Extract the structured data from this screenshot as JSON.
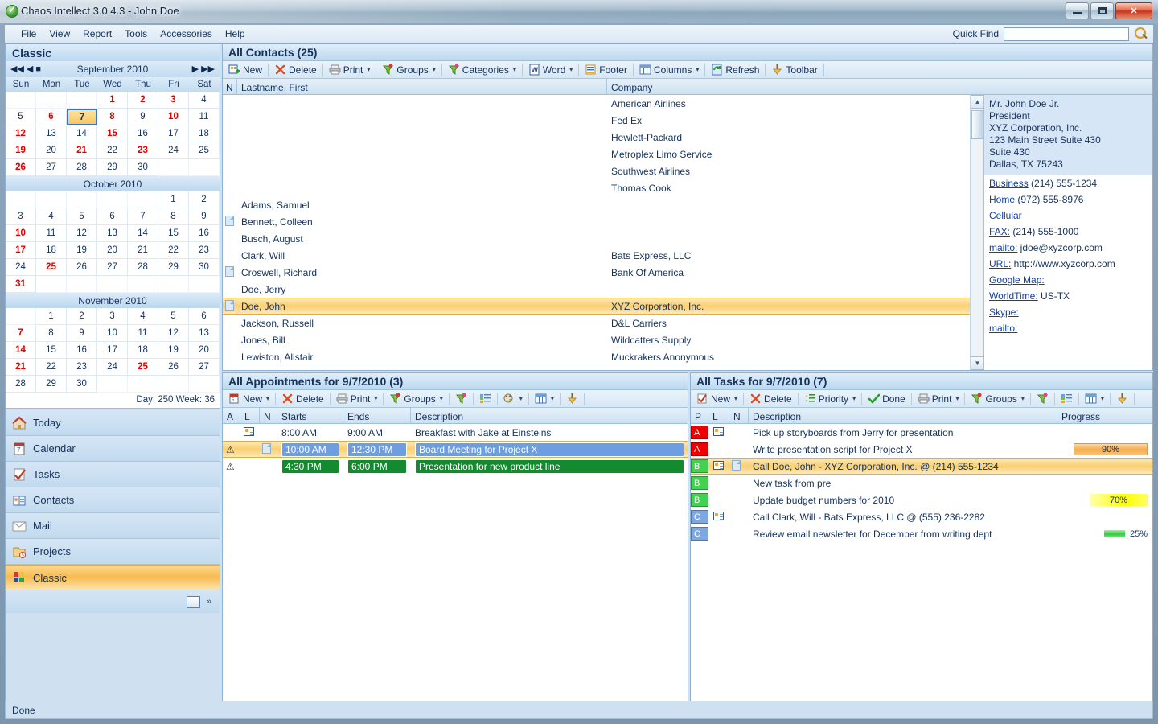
{
  "window": {
    "title": "Chaos Intellect 3.0.4.3 - John Doe",
    "minimize": "–",
    "maximize": "□",
    "close": "✕"
  },
  "menubar": {
    "items": [
      "File",
      "View",
      "Report",
      "Tools",
      "Accessories",
      "Help"
    ],
    "quick_find_label": "Quick Find",
    "quick_find_value": "",
    "quick_find_placeholder": ""
  },
  "sidebar": {
    "title": "Classic",
    "nav": {
      "first": "◀◀",
      "prev": "◀",
      "today": "■",
      "next": "▶",
      "last": "▶▶"
    },
    "dow": [
      "Sun",
      "Mon",
      "Tue",
      "Wed",
      "Thu",
      "Fri",
      "Sat"
    ],
    "months": [
      {
        "label": "September 2010",
        "lead_blanks": 3,
        "days": [
          {
            "n": 1,
            "hl": true
          },
          {
            "n": 2,
            "hl": true
          },
          {
            "n": 3,
            "hl": true
          },
          {
            "n": 4,
            "hl": false
          },
          {
            "n": 5,
            "hl": false
          },
          {
            "n": 6,
            "hl": true
          },
          {
            "n": 7,
            "hl": false,
            "sel": true
          },
          {
            "n": 8,
            "hl": true
          },
          {
            "n": 9,
            "hl": false
          },
          {
            "n": 10,
            "hl": true
          },
          {
            "n": 11,
            "hl": false
          },
          {
            "n": 12,
            "hl": true
          },
          {
            "n": 13,
            "hl": false
          },
          {
            "n": 14,
            "hl": false
          },
          {
            "n": 15,
            "hl": true
          },
          {
            "n": 16,
            "hl": false
          },
          {
            "n": 17,
            "hl": false
          },
          {
            "n": 18,
            "hl": false
          },
          {
            "n": 19,
            "hl": true
          },
          {
            "n": 20,
            "hl": false
          },
          {
            "n": 21,
            "hl": true
          },
          {
            "n": 22,
            "hl": false
          },
          {
            "n": 23,
            "hl": true
          },
          {
            "n": 24,
            "hl": false
          },
          {
            "n": 25,
            "hl": false
          },
          {
            "n": 26,
            "hl": true
          },
          {
            "n": 27,
            "hl": false
          },
          {
            "n": 28,
            "hl": false
          },
          {
            "n": 29,
            "hl": false
          },
          {
            "n": 30,
            "hl": false
          }
        ]
      },
      {
        "label": "October 2010",
        "lead_blanks": 5,
        "days": [
          {
            "n": 1,
            "hl": false
          },
          {
            "n": 2,
            "hl": false
          },
          {
            "n": 3,
            "hl": false
          },
          {
            "n": 4,
            "hl": false
          },
          {
            "n": 5,
            "hl": false
          },
          {
            "n": 6,
            "hl": false
          },
          {
            "n": 7,
            "hl": false
          },
          {
            "n": 8,
            "hl": false
          },
          {
            "n": 9,
            "hl": false
          },
          {
            "n": 10,
            "hl": true
          },
          {
            "n": 11,
            "hl": false
          },
          {
            "n": 12,
            "hl": false
          },
          {
            "n": 13,
            "hl": false
          },
          {
            "n": 14,
            "hl": false
          },
          {
            "n": 15,
            "hl": false
          },
          {
            "n": 16,
            "hl": false
          },
          {
            "n": 17,
            "hl": true
          },
          {
            "n": 18,
            "hl": false
          },
          {
            "n": 19,
            "hl": false
          },
          {
            "n": 20,
            "hl": false
          },
          {
            "n": 21,
            "hl": false
          },
          {
            "n": 22,
            "hl": false
          },
          {
            "n": 23,
            "hl": false
          },
          {
            "n": 24,
            "hl": false
          },
          {
            "n": 25,
            "hl": true
          },
          {
            "n": 26,
            "hl": false
          },
          {
            "n": 27,
            "hl": false
          },
          {
            "n": 28,
            "hl": false
          },
          {
            "n": 29,
            "hl": false
          },
          {
            "n": 30,
            "hl": false
          },
          {
            "n": 31,
            "hl": true
          }
        ]
      },
      {
        "label": "November 2010",
        "lead_blanks": 1,
        "days": [
          {
            "n": 1,
            "hl": false
          },
          {
            "n": 2,
            "hl": false
          },
          {
            "n": 3,
            "hl": false
          },
          {
            "n": 4,
            "hl": false
          },
          {
            "n": 5,
            "hl": false
          },
          {
            "n": 6,
            "hl": false
          },
          {
            "n": 7,
            "hl": true
          },
          {
            "n": 8,
            "hl": false
          },
          {
            "n": 9,
            "hl": false
          },
          {
            "n": 10,
            "hl": false
          },
          {
            "n": 11,
            "hl": false
          },
          {
            "n": 12,
            "hl": false
          },
          {
            "n": 13,
            "hl": false
          },
          {
            "n": 14,
            "hl": true
          },
          {
            "n": 15,
            "hl": false
          },
          {
            "n": 16,
            "hl": false
          },
          {
            "n": 17,
            "hl": false
          },
          {
            "n": 18,
            "hl": false
          },
          {
            "n": 19,
            "hl": false
          },
          {
            "n": 20,
            "hl": false
          },
          {
            "n": 21,
            "hl": true
          },
          {
            "n": 22,
            "hl": false
          },
          {
            "n": 23,
            "hl": false
          },
          {
            "n": 24,
            "hl": false
          },
          {
            "n": 25,
            "hl": true
          },
          {
            "n": 26,
            "hl": false
          },
          {
            "n": 27,
            "hl": false
          },
          {
            "n": 28,
            "hl": false
          },
          {
            "n": 29,
            "hl": false
          },
          {
            "n": 30,
            "hl": false
          }
        ]
      }
    ],
    "daynum": "Day: 250  Week: 36",
    "items": [
      {
        "label": "Today",
        "icon": "today-icon",
        "active": false
      },
      {
        "label": "Calendar",
        "icon": "calendar-icon",
        "active": false
      },
      {
        "label": "Tasks",
        "icon": "tasks-icon",
        "active": false
      },
      {
        "label": "Contacts",
        "icon": "contacts-icon",
        "active": false
      },
      {
        "label": "Mail",
        "icon": "mail-icon",
        "active": false
      },
      {
        "label": "Projects",
        "icon": "projects-icon",
        "active": false
      },
      {
        "label": "Classic",
        "icon": "classic-icon",
        "active": true
      }
    ]
  },
  "contacts": {
    "header": "All Contacts (25)",
    "toolbar": [
      {
        "label": "New",
        "icon": "new-contact-icon",
        "caret": false
      },
      {
        "label": "Delete",
        "icon": "delete-x-icon",
        "caret": false
      },
      {
        "label": "Print",
        "icon": "printer-icon",
        "caret": true
      },
      {
        "label": "Groups",
        "icon": "funnel-red-icon",
        "caret": true
      },
      {
        "label": "Categories",
        "icon": "funnel-green-icon",
        "caret": true
      },
      {
        "label": "Word",
        "icon": "word-icon",
        "caret": true
      },
      {
        "label": "Footer",
        "icon": "footer-icon",
        "caret": false
      },
      {
        "label": "Columns",
        "icon": "columns-icon",
        "caret": true
      },
      {
        "label": "Refresh",
        "icon": "refresh-icon",
        "caret": false
      },
      {
        "label": "Toolbar",
        "icon": "toolbar-icon",
        "caret": false
      }
    ],
    "columns": [
      "N",
      "Lastname, First",
      "Company"
    ],
    "rows": [
      {
        "note": false,
        "name": "",
        "company": "American Airlines",
        "selected": false
      },
      {
        "note": false,
        "name": "",
        "company": "Fed Ex",
        "selected": false
      },
      {
        "note": false,
        "name": "",
        "company": "Hewlett-Packard",
        "selected": false
      },
      {
        "note": false,
        "name": "",
        "company": "Metroplex Limo Service",
        "selected": false
      },
      {
        "note": false,
        "name": "",
        "company": "Southwest Airlines",
        "selected": false
      },
      {
        "note": false,
        "name": "",
        "company": "Thomas Cook",
        "selected": false
      },
      {
        "note": false,
        "name": "Adams, Samuel",
        "company": "",
        "selected": false
      },
      {
        "note": true,
        "name": "Bennett, Colleen",
        "company": "",
        "selected": false
      },
      {
        "note": false,
        "name": "Busch, August",
        "company": "",
        "selected": false
      },
      {
        "note": false,
        "name": "Clark, Will",
        "company": "Bats Express, LLC",
        "selected": false
      },
      {
        "note": true,
        "name": "Croswell, Richard",
        "company": "Bank Of America",
        "selected": false
      },
      {
        "note": false,
        "name": "Doe, Jerry",
        "company": "",
        "selected": false
      },
      {
        "note": true,
        "name": "Doe, John",
        "company": "XYZ Corporation, Inc.",
        "selected": true
      },
      {
        "note": false,
        "name": "Jackson, Russell",
        "company": "D&L  Carriers",
        "selected": false
      },
      {
        "note": false,
        "name": "Jones, Bill",
        "company": "Wildcatters Supply",
        "selected": false
      },
      {
        "note": false,
        "name": "Lewiston, Alistair",
        "company": "Muckrakers Anonymous",
        "selected": false
      }
    ],
    "detail": {
      "address_lines": [
        "Mr. John Doe Jr.",
        "President",
        "XYZ Corporation, Inc.",
        "123 Main Street Suite 430",
        "Suite 430",
        "Dallas, TX 75243"
      ],
      "fields": [
        {
          "link": "Business",
          "value": "(214) 555-1234"
        },
        {
          "link": "Home",
          "value": "(972) 555-8976"
        },
        {
          "link": "Cellular",
          "value": ""
        },
        {
          "link": "FAX:",
          "value": "(214) 555-1000"
        },
        {
          "link": "mailto:",
          "value": "jdoe@xyzcorp.com"
        },
        {
          "link": "URL:",
          "value": "http://www.xyzcorp.com"
        },
        {
          "link": "Google Map:",
          "value": ""
        },
        {
          "link": "WorldTime:",
          "value": "US-TX"
        },
        {
          "link": "Skype:",
          "value": ""
        },
        {
          "link": "mailto:",
          "value": ""
        }
      ]
    }
  },
  "appointments": {
    "header": "All Appointments for 9/7/2010 (3)",
    "toolbar": [
      {
        "label": "New",
        "icon": "new-appointment-icon",
        "caret": true
      },
      {
        "label": "Delete",
        "icon": "delete-x-icon",
        "caret": false
      },
      {
        "label": "Print",
        "icon": "printer-icon",
        "caret": true
      },
      {
        "label": "Groups",
        "icon": "funnel-red-icon",
        "caret": true
      },
      {
        "label": "",
        "icon": "funnel-green-icon",
        "caret": false
      },
      {
        "label": "",
        "icon": "outline-icon",
        "caret": false
      },
      {
        "label": "",
        "icon": "colors-icon",
        "caret": true
      },
      {
        "label": "",
        "icon": "columns-icon",
        "caret": true
      },
      {
        "label": "",
        "icon": "toolbar-icon",
        "caret": false
      }
    ],
    "columns": [
      "A",
      "L",
      "N",
      "Starts",
      "Ends",
      "Description"
    ],
    "rows": [
      {
        "alarm": false,
        "link": "card",
        "note": false,
        "starts": "8:00 AM",
        "ends": "9:00 AM",
        "description": "Breakfast with Jake at Einsteins",
        "style": "none",
        "selected": false
      },
      {
        "alarm": true,
        "link": "",
        "note": true,
        "starts": "10:00 AM",
        "ends": "12:30 PM",
        "description": "Board Meeting for Project X",
        "style": "blue",
        "selected": true
      },
      {
        "alarm": true,
        "link": "",
        "note": false,
        "starts": "4:30 PM",
        "ends": "6:00 PM",
        "description": "Presentation for new product line",
        "style": "green",
        "selected": false
      }
    ]
  },
  "tasks": {
    "header": "All Tasks for 9/7/2010 (7)",
    "toolbar": [
      {
        "label": "New",
        "icon": "new-task-icon",
        "caret": true
      },
      {
        "label": "Delete",
        "icon": "delete-x-icon",
        "caret": false
      },
      {
        "label": "Priority",
        "icon": "priority-icon",
        "caret": true
      },
      {
        "label": "Done",
        "icon": "check-icon",
        "caret": false
      },
      {
        "label": "Print",
        "icon": "printer-icon",
        "caret": true
      },
      {
        "label": "Groups",
        "icon": "funnel-red-icon",
        "caret": true
      },
      {
        "label": "",
        "icon": "funnel-green-icon",
        "caret": false
      },
      {
        "label": "",
        "icon": "outline-icon",
        "caret": false
      },
      {
        "label": "",
        "icon": "columns-icon",
        "caret": true
      },
      {
        "label": "",
        "icon": "toolbar-icon",
        "caret": false
      }
    ],
    "columns": [
      "P",
      "L",
      "N",
      "Description",
      "Progress"
    ],
    "rows": [
      {
        "priority": "A",
        "link": "card",
        "note": false,
        "description": "Pick up storyboards from Jerry for presentation",
        "progress": "",
        "progress_pct": 0,
        "bar": "none",
        "selected": false
      },
      {
        "priority": "A",
        "link": "",
        "note": false,
        "description": "Write presentation script for Project X",
        "progress": "90%",
        "progress_pct": 90,
        "bar": "orange",
        "selected": false
      },
      {
        "priority": "B",
        "link": "card",
        "note": true,
        "description": "Call Doe, John - XYZ Corporation, Inc. @ (214) 555-1234",
        "progress": "",
        "progress_pct": 0,
        "bar": "none",
        "selected": true
      },
      {
        "priority": "B",
        "link": "",
        "note": false,
        "description": "New task from pre",
        "progress": "",
        "progress_pct": 0,
        "bar": "none",
        "selected": false
      },
      {
        "priority": "B",
        "link": "",
        "note": false,
        "description": "Update budget numbers for 2010",
        "progress": "70%",
        "progress_pct": 70,
        "bar": "yellow",
        "selected": false
      },
      {
        "priority": "C",
        "link": "card",
        "note": false,
        "description": "Call Clark, Will - Bats Express, LLC @ (555) 236-2282",
        "progress": "",
        "progress_pct": 0,
        "bar": "none",
        "selected": false
      },
      {
        "priority": "C",
        "link": "",
        "note": false,
        "description": "Review email newsletter for December from writing dept",
        "progress": "25%",
        "progress_pct": 25,
        "bar": "green",
        "selected": false
      }
    ]
  },
  "statusbar": {
    "text": "Done"
  },
  "colors": {
    "accent_blue": "#1a3260",
    "selection_gold": "#f9cf72",
    "priority_a": "#ef0000",
    "priority_b": "#44d152",
    "priority_c": "#7fa8e0",
    "progress_orange": "#f5ab4d",
    "progress_yellow": "#ffff00",
    "progress_green": "#2ecc40",
    "appt_blue": "#6d9ee0",
    "appt_green": "#138a2e"
  }
}
